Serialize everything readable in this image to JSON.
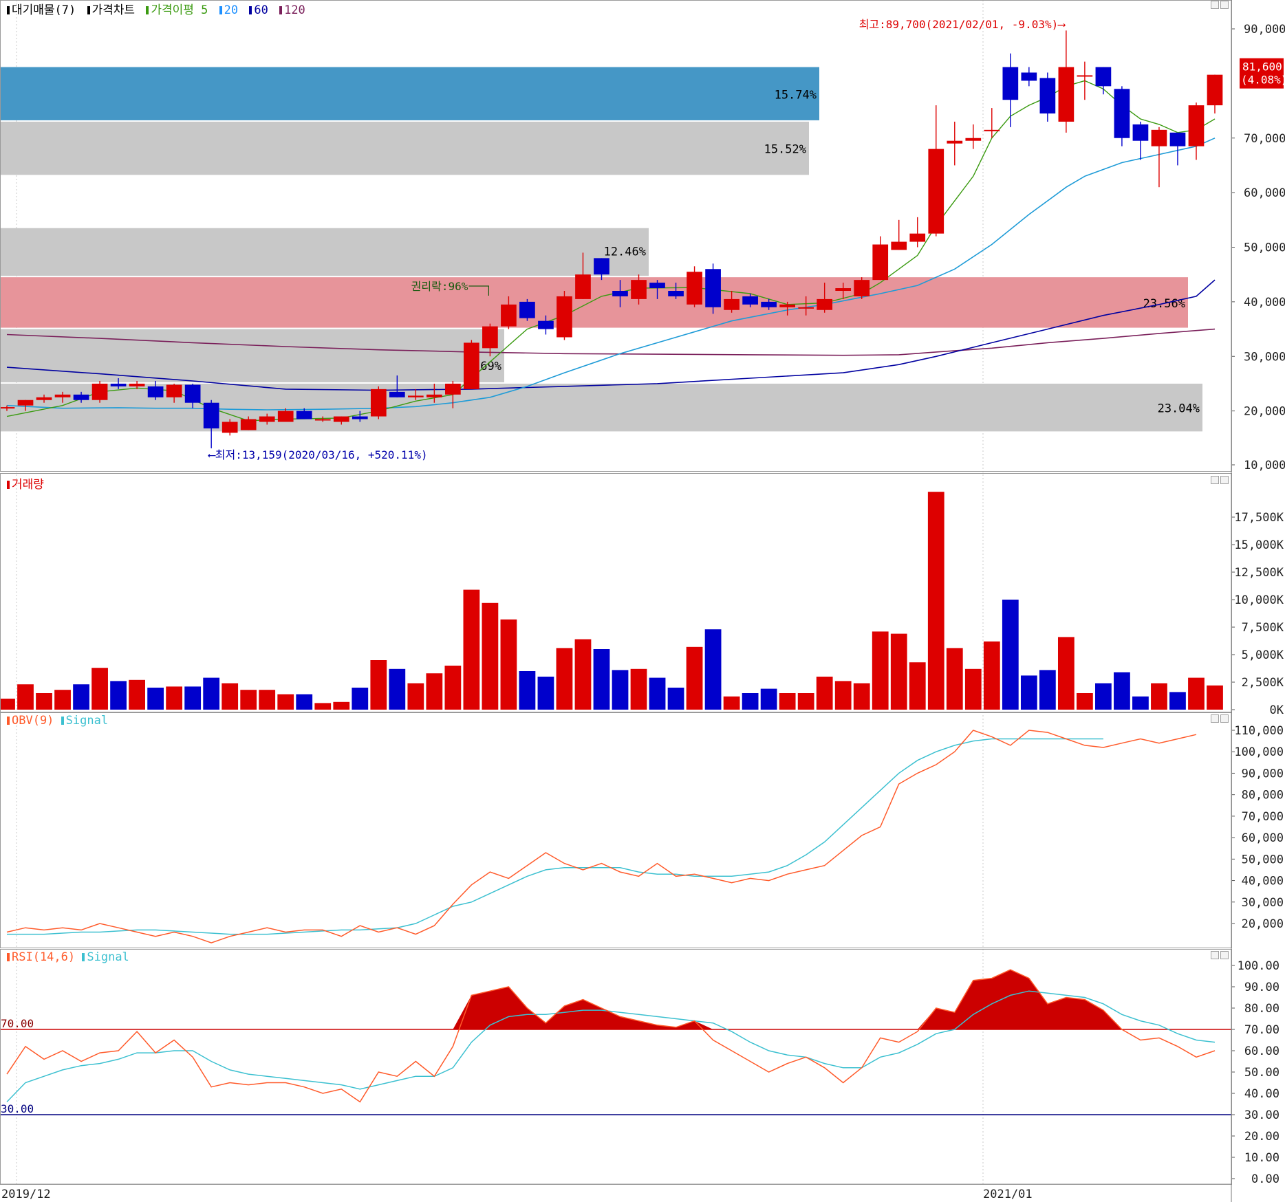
{
  "price_panel": {
    "legend": [
      {
        "label": "대기매물(7)",
        "color": "#000000"
      },
      {
        "label": "가격차트",
        "color": "#000000"
      },
      {
        "label": "가격이평 5",
        "color": "#3a9a10"
      },
      {
        "label": "20",
        "color": "#1e90ff"
      },
      {
        "label": "60",
        "color": "#0000a0"
      },
      {
        "label": "120",
        "color": "#7a1f5a"
      }
    ],
    "high_note": "최고:89,700(2021/02/01, -9.03%)⟶",
    "low_note": "⟵최저:13,159(2020/03/16, +520.11%)",
    "ex_rights_note": "권리락:96%",
    "last_price": "81,600",
    "last_change": "(4.08%)",
    "axis_labels": [
      "90,000",
      "70,000",
      "60,000",
      "50,000",
      "40,000",
      "30,000",
      "20,000",
      "10,000"
    ]
  },
  "volume_panel": {
    "title": "거래량",
    "axis_labels": [
      "17,500K",
      "15,000K",
      "12,500K",
      "10,000K",
      "7,500K",
      "5,000K",
      "2,500K",
      "0K"
    ]
  },
  "obv_panel": {
    "title_a": "OBV(9)",
    "title_b": "Signal",
    "axis_labels": [
      "110,000",
      "100,000",
      "90,000",
      "80,000",
      "70,000",
      "60,000",
      "50,000",
      "40,000",
      "30,000",
      "20,000"
    ]
  },
  "rsi_panel": {
    "title_a": "RSI(14,6)",
    "title_b": "Signal",
    "upper_label": "70.00",
    "lower_label": "30.00",
    "axis_labels": [
      "100.00",
      "90.00",
      "80.00",
      "70.00",
      "60.00",
      "50.00",
      "40.00",
      "30.00",
      "20.00",
      "10.00",
      "0.00"
    ]
  },
  "x_axis": {
    "left_label": "2019/12",
    "right_label": "2021/01"
  },
  "colors": {
    "up": "#dd0000",
    "down": "#0000cc",
    "ma5": "#3a9a10",
    "ma20": "#1e9bd7",
    "ma60": "#0000a0",
    "ma120": "#7a1f5a",
    "obv": "#ff5a2a",
    "signal": "#3cc0d0"
  },
  "chart_data": {
    "type": "candlestick",
    "price_ylim": [
      10000,
      95000
    ],
    "supply_zones": [
      {
        "low": 73000,
        "high": 83000,
        "pct": "15.74%",
        "highlight": "blue"
      },
      {
        "low": 63000,
        "high": 73000,
        "pct": "15.52%",
        "highlight": "none"
      },
      {
        "low": 44500,
        "high": 53500,
        "pct": "12.46%",
        "highlight": "none"
      },
      {
        "low": 35000,
        "high": 44500,
        "pct": "23.56%",
        "highlight": "red"
      },
      {
        "low": 25000,
        "high": 35000,
        "pct": "9.69%",
        "highlight": "none"
      },
      {
        "low": 16000,
        "high": 25000,
        "pct": "23.04%",
        "highlight": "none"
      }
    ],
    "candles": [
      [
        20500,
        21000,
        20000,
        20700
      ],
      [
        21000,
        22000,
        20000,
        22000
      ],
      [
        22000,
        23000,
        21500,
        22500
      ],
      [
        22500,
        23500,
        21500,
        23000
      ],
      [
        23000,
        23500,
        21500,
        22000
      ],
      [
        22000,
        25500,
        21500,
        25000
      ],
      [
        25000,
        26000,
        24000,
        24500
      ],
      [
        24500,
        25500,
        24000,
        25000
      ],
      [
        24500,
        25500,
        22000,
        22500
      ],
      [
        22500,
        25000,
        21500,
        24800
      ],
      [
        24800,
        25000,
        20500,
        21500
      ],
      [
        21500,
        22000,
        13159,
        16800
      ],
      [
        16000,
        18500,
        15500,
        18000
      ],
      [
        16500,
        19000,
        16500,
        18500
      ],
      [
        18000,
        19500,
        17500,
        19000
      ],
      [
        18000,
        20500,
        18000,
        20000
      ],
      [
        20000,
        20500,
        18500,
        18500
      ],
      [
        18500,
        19000,
        18000,
        18500
      ],
      [
        18000,
        19000,
        17500,
        19000
      ],
      [
        19000,
        20000,
        18000,
        18500
      ],
      [
        19000,
        24500,
        18500,
        24000
      ],
      [
        23500,
        26500,
        22500,
        22500
      ],
      [
        22500,
        24000,
        22000,
        22800
      ],
      [
        22500,
        25000,
        21500,
        23000
      ],
      [
        23000,
        25500,
        20500,
        25000
      ],
      [
        24000,
        33000,
        24000,
        32500
      ],
      [
        31500,
        36000,
        30000,
        35500
      ],
      [
        35500,
        41000,
        35000,
        39500
      ],
      [
        40000,
        40500,
        36500,
        37000
      ],
      [
        36500,
        37500,
        34000,
        35000
      ],
      [
        33500,
        42000,
        33000,
        41000
      ],
      [
        40500,
        49000,
        40500,
        45000
      ],
      [
        48000,
        48000,
        44000,
        45000
      ],
      [
        42000,
        44000,
        39000,
        41000
      ],
      [
        40500,
        45000,
        39500,
        44000
      ],
      [
        43500,
        44000,
        40500,
        42500
      ],
      [
        42000,
        43500,
        40500,
        41000
      ],
      [
        39500,
        46500,
        39000,
        45500
      ],
      [
        46000,
        47000,
        37800,
        39000
      ],
      [
        38500,
        42000,
        38000,
        40500
      ],
      [
        41000,
        41500,
        39000,
        39500
      ],
      [
        40000,
        40500,
        38500,
        39000
      ],
      [
        39000,
        40000,
        37500,
        39500
      ],
      [
        39000,
        41000,
        37500,
        39000
      ],
      [
        38500,
        43500,
        38000,
        40500
      ],
      [
        42000,
        43500,
        40500,
        42500
      ],
      [
        41000,
        44500,
        40500,
        44000
      ],
      [
        44000,
        52000,
        44000,
        50500
      ],
      [
        49500,
        55000,
        49500,
        51000
      ],
      [
        51000,
        55500,
        50000,
        52500
      ],
      [
        52500,
        76000,
        52000,
        68000
      ],
      [
        69000,
        73000,
        65000,
        69500
      ],
      [
        69500,
        72500,
        68000,
        70000
      ],
      [
        71500,
        75500,
        70000,
        71500
      ],
      [
        83000,
        85500,
        72000,
        77000
      ],
      [
        82000,
        83000,
        79500,
        80500
      ],
      [
        81000,
        82000,
        73000,
        74500
      ],
      [
        73000,
        89700,
        71000,
        83000
      ],
      [
        81500,
        84000,
        77000,
        81500
      ],
      [
        83000,
        83000,
        78000,
        79500
      ],
      [
        79000,
        79500,
        68500,
        70000
      ],
      [
        72500,
        73000,
        66000,
        69500
      ],
      [
        68500,
        72000,
        61000,
        71500
      ],
      [
        71000,
        70500,
        65000,
        68500
      ],
      [
        68500,
        76500,
        66000,
        76000
      ],
      [
        76000,
        81600,
        74500,
        81600
      ]
    ],
    "ma5": [
      [
        0,
        19000
      ],
      [
        3,
        21000
      ],
      [
        5,
        23500
      ],
      [
        7,
        24200
      ],
      [
        9,
        23700
      ],
      [
        11,
        20500
      ],
      [
        13,
        18200
      ],
      [
        15,
        18500
      ],
      [
        18,
        18700
      ],
      [
        20,
        20000
      ],
      [
        22,
        21800
      ],
      [
        24,
        23000
      ],
      [
        26,
        29000
      ],
      [
        28,
        35000
      ],
      [
        30,
        37500
      ],
      [
        32,
        41000
      ],
      [
        34,
        42500
      ],
      [
        37,
        42600
      ],
      [
        40,
        41500
      ],
      [
        42,
        39500
      ],
      [
        44,
        39800
      ],
      [
        46,
        41500
      ],
      [
        47,
        43500
      ],
      [
        49,
        48500
      ],
      [
        50,
        54000
      ],
      [
        52,
        63000
      ],
      [
        53,
        70000
      ],
      [
        54,
        74000
      ],
      [
        55,
        76000
      ],
      [
        56,
        77500
      ],
      [
        57,
        79500
      ],
      [
        58,
        80500
      ],
      [
        59,
        79000
      ],
      [
        60,
        76000
      ],
      [
        61,
        73500
      ],
      [
        62,
        72500
      ],
      [
        63,
        71000
      ],
      [
        64,
        71500
      ],
      [
        65,
        73500
      ]
    ],
    "ma20": [
      [
        0,
        21000
      ],
      [
        3,
        20500
      ],
      [
        6,
        20600
      ],
      [
        8,
        20500
      ],
      [
        10,
        20500
      ],
      [
        12,
        20300
      ],
      [
        14,
        20200
      ],
      [
        17,
        20300
      ],
      [
        20,
        20500
      ],
      [
        22,
        20800
      ],
      [
        24,
        21500
      ],
      [
        26,
        22500
      ],
      [
        28,
        24500
      ],
      [
        30,
        27000
      ],
      [
        33,
        30500
      ],
      [
        36,
        33500
      ],
      [
        39,
        36500
      ],
      [
        42,
        38500
      ],
      [
        44,
        39500
      ],
      [
        47,
        41500
      ],
      [
        49,
        43000
      ],
      [
        51,
        46000
      ],
      [
        53,
        50500
      ],
      [
        55,
        56000
      ],
      [
        57,
        61000
      ],
      [
        58,
        63000
      ],
      [
        60,
        65500
      ],
      [
        62,
        67000
      ],
      [
        64,
        68500
      ],
      [
        65,
        70000
      ]
    ],
    "ma60": [
      [
        0,
        28000
      ],
      [
        5,
        26800
      ],
      [
        10,
        25500
      ],
      [
        15,
        24000
      ],
      [
        20,
        23800
      ],
      [
        25,
        24000
      ],
      [
        30,
        24500
      ],
      [
        35,
        25000
      ],
      [
        40,
        26000
      ],
      [
        45,
        27000
      ],
      [
        48,
        28500
      ],
      [
        50,
        30000
      ],
      [
        53,
        32500
      ],
      [
        56,
        35000
      ],
      [
        59,
        37500
      ],
      [
        62,
        39500
      ],
      [
        64,
        41000
      ],
      [
        65,
        44000
      ]
    ],
    "ma120": [
      [
        0,
        34000
      ],
      [
        5,
        33300
      ],
      [
        10,
        32500
      ],
      [
        15,
        31800
      ],
      [
        20,
        31200
      ],
      [
        25,
        30800
      ],
      [
        30,
        30500
      ],
      [
        35,
        30400
      ],
      [
        40,
        30300
      ],
      [
        45,
        30200
      ],
      [
        48,
        30300
      ],
      [
        50,
        30800
      ],
      [
        53,
        31500
      ],
      [
        56,
        32500
      ],
      [
        59,
        33300
      ],
      [
        62,
        34200
      ],
      [
        65,
        35000
      ]
    ],
    "volume_k": [
      1000,
      2300,
      1500,
      1800,
      2300,
      3800,
      2600,
      2700,
      2000,
      2100,
      2100,
      2900,
      2400,
      1800,
      1800,
      1400,
      1400,
      600,
      700,
      2000,
      4500,
      3700,
      2400,
      3300,
      4000,
      10900,
      9700,
      8200,
      3500,
      3000,
      5600,
      6400,
      5500,
      3600,
      3700,
      2900,
      2000,
      5700,
      7300,
      1200,
      1500,
      1900,
      1500,
      1500,
      3000,
      2600,
      2400,
      7100,
      6900,
      4300,
      19800,
      5600,
      3700,
      6200,
      10000,
      3100,
      3600,
      6600,
      1500,
      2400,
      3400,
      1200,
      2400,
      1600,
      2900,
      2200
    ],
    "volume_ylim": [
      0,
      20000
    ],
    "obv_k": [
      16,
      18,
      17,
      18,
      17,
      20,
      18,
      16,
      14,
      16,
      14,
      11,
      14,
      16,
      18,
      16,
      17,
      17,
      14,
      19,
      16,
      18,
      15,
      19,
      29,
      38,
      44,
      41,
      47,
      53,
      48,
      45,
      48,
      44,
      42,
      48,
      42,
      43,
      41,
      39,
      41,
      40,
      43,
      45,
      47,
      54,
      61,
      65,
      85,
      90,
      94,
      100,
      110,
      107,
      103,
      110,
      109,
      106,
      103,
      102,
      104,
      106,
      104,
      106,
      108
    ],
    "obv_signal_k": [
      15,
      15,
      15,
      15.5,
      16,
      16,
      16.5,
      17,
      17,
      16.5,
      16,
      15.5,
      15,
      15,
      15,
      15.5,
      16,
      16.5,
      17,
      17,
      17.5,
      18,
      20,
      24,
      28,
      30,
      34,
      38,
      42,
      45,
      46,
      46,
      46,
      46,
      44,
      43,
      43,
      42,
      42,
      42,
      43,
      44,
      47,
      52,
      58,
      66,
      74,
      82,
      90,
      96,
      100,
      103,
      105,
      106,
      106,
      106,
      106,
      106,
      106,
      106
    ],
    "rsi": [
      49,
      62,
      56,
      60,
      55,
      59,
      60,
      69,
      59,
      65,
      57,
      43,
      45,
      44,
      45,
      45,
      43,
      40,
      42,
      36,
      50,
      48,
      55,
      48,
      62,
      86,
      88,
      90,
      80,
      73,
      81,
      84,
      80,
      76,
      74,
      72,
      71,
      74,
      65,
      60,
      55,
      50,
      54,
      57,
      52,
      45,
      52,
      66,
      64,
      69,
      80,
      78,
      93,
      94,
      98,
      94,
      82,
      85,
      84,
      79,
      70,
      65,
      66,
      62,
      57,
      60
    ],
    "rsi_signal": [
      36,
      45,
      48,
      51,
      53,
      54,
      56,
      59,
      59,
      60,
      60,
      55,
      51,
      49,
      48,
      47,
      46,
      45,
      44,
      42,
      44,
      46,
      48,
      48,
      52,
      64,
      72,
      76,
      77,
      77,
      78,
      79,
      79,
      78,
      77,
      76,
      75,
      74,
      73,
      69,
      64,
      60,
      58,
      57,
      54,
      52,
      52,
      57,
      59,
      63,
      68,
      70,
      77,
      82,
      86,
      88,
      87,
      86,
      85,
      82,
      77,
      74,
      72,
      68,
      65,
      64
    ],
    "rsi_levels": [
      30,
      70
    ]
  }
}
